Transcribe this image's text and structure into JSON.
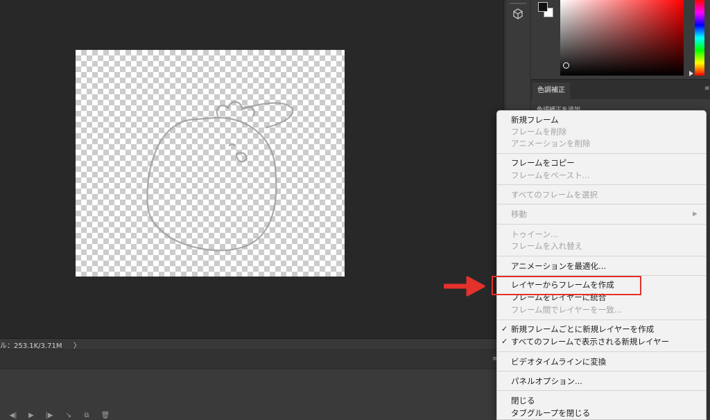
{
  "status_bar": {
    "text": "ル：253.1K/3.71M",
    "arrow": "〉"
  },
  "timeline": {
    "menu_glyph": "≡",
    "controls": [
      "◀|",
      "▶",
      "|▶",
      "↘",
      "⧉",
      "🗑"
    ]
  },
  "adjustments": {
    "tab_label": "色調補正",
    "subtitle": "色調補正を追加",
    "menu_glyph": "≡"
  },
  "colors": {
    "annotation": "#e3312b",
    "menu_bg": "#f2f2f2",
    "workspace_bg": "#282828"
  },
  "context_menu": {
    "new_frame": "新規フレーム",
    "delete_frame": "フレームを削除",
    "delete_animation": "アニメーションを削除",
    "copy_frame": "フレームをコピー",
    "paste_frame": "フレームをペースト...",
    "select_all_frames": "すべてのフレームを選択",
    "move": "移動",
    "move_submenu": "▶",
    "tween": "トゥイーン...",
    "reverse_frames": "フレームを入れ替え",
    "optimize_animation": "アニメーションを最適化...",
    "make_frames_from_layers": "レイヤーからフレームを作成",
    "flatten_frames_into_layers": "フレームをレイヤーに統合",
    "match_layer_across_frames": "フレーム間でレイヤーを一致...",
    "create_new_layer_each_frame": "新規フレームごとに新規レイヤーを作成",
    "new_layers_visible_all_frames": "すべてのフレームで表示される新規レイヤー",
    "check_mark": "✓",
    "convert_to_video_timeline": "ビデオタイムラインに変換",
    "panel_options": "パネルオプション...",
    "close": "閉じる",
    "close_tab_group": "タブグループを閉じる"
  }
}
